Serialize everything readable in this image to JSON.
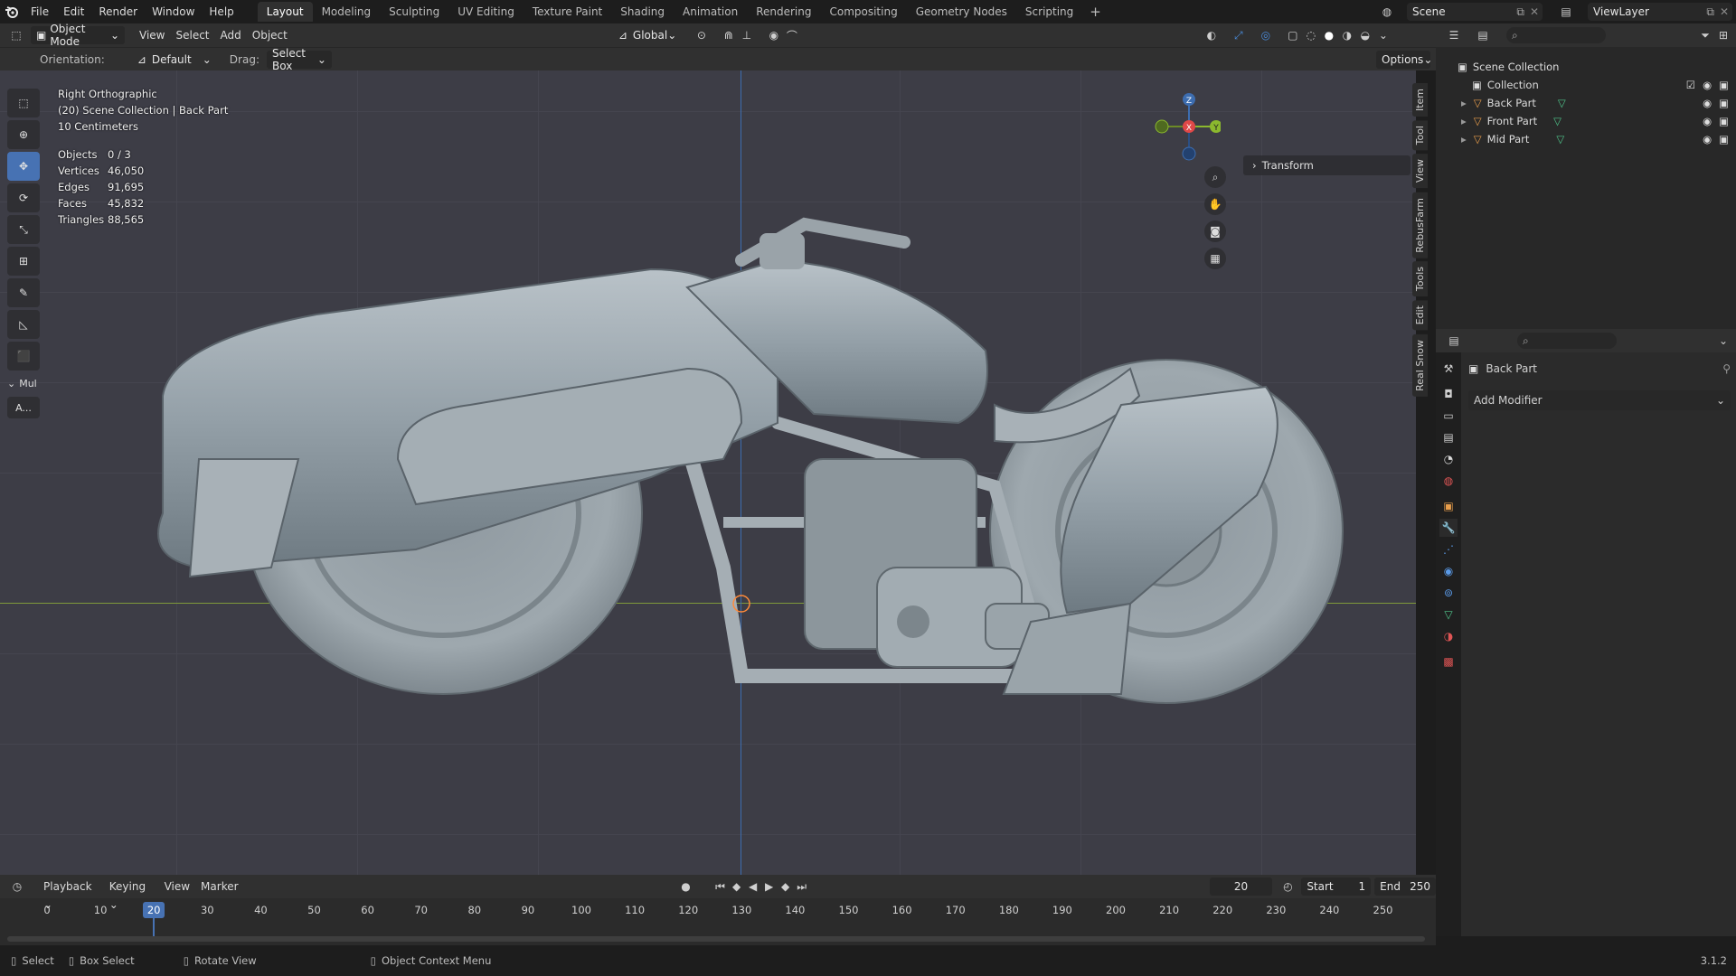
{
  "menu": [
    "File",
    "Edit",
    "Render",
    "Window",
    "Help"
  ],
  "workspaces": [
    "Layout",
    "Modeling",
    "Sculpting",
    "UV Editing",
    "Texture Paint",
    "Shading",
    "Animation",
    "Rendering",
    "Compositing",
    "Geometry Nodes",
    "Scripting"
  ],
  "active_workspace": "Layout",
  "scene_name": "Scene",
  "view_layer": "ViewLayer",
  "header": {
    "mode": "Object Mode",
    "view": "View",
    "select": "Select",
    "add": "Add",
    "object": "Object",
    "transform_orientation": "Global"
  },
  "tool_settings": {
    "orientation_label": "Orientation:",
    "orientation_value": "Default",
    "drag_label": "Drag:",
    "drag_value": "Select Box",
    "options": "Options"
  },
  "viewport": {
    "view_name": "Right Orthographic",
    "context": "(20) Scene Collection | Back Part",
    "scale": "10 Centimeters",
    "stats": [
      {
        "label": "Objects",
        "value": "0 / 3"
      },
      {
        "label": "Vertices",
        "value": "46,050"
      },
      {
        "label": "Edges",
        "value": "91,695"
      },
      {
        "label": "Faces",
        "value": "45,832"
      },
      {
        "label": "Triangles",
        "value": "88,565"
      }
    ],
    "transform_panel": "Transform",
    "sidebar_tabs": [
      "Item",
      "Tool",
      "View",
      "RebusFarm",
      "Tools",
      "Edit",
      "Real Snow"
    ],
    "gizmo": {
      "z": "Z",
      "x": "X",
      "y": "Y"
    },
    "tool_panel_label": "Mul",
    "tool_panel_button": "A..."
  },
  "outliner": {
    "root": "Scene Collection",
    "collection": "Collection",
    "objects": [
      "Back Part",
      "Front Part",
      "Mid Part"
    ]
  },
  "properties": {
    "object_name": "Back Part",
    "add_modifier": "Add Modifier"
  },
  "timeline": {
    "menus": [
      "Playback",
      "Keying",
      "View",
      "Marker"
    ],
    "current_frame": "20",
    "start_label": "Start",
    "start": "1",
    "end_label": "End",
    "end": "250",
    "ticks": [
      "0",
      "10",
      "20",
      "30",
      "40",
      "50",
      "60",
      "70",
      "80",
      "90",
      "100",
      "110",
      "120",
      "130",
      "140",
      "150",
      "160",
      "170",
      "180",
      "190",
      "200",
      "210",
      "220",
      "230",
      "240",
      "250"
    ]
  },
  "status": {
    "select": "Select",
    "box_select": "Box Select",
    "rotate_view": "Rotate View",
    "context_menu": "Object Context Menu",
    "version": "3.1.2"
  }
}
